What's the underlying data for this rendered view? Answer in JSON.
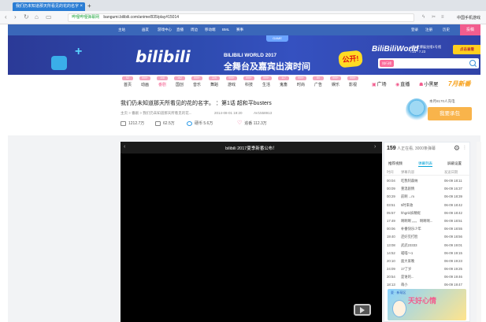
{
  "browser": {
    "tab_title": "我们仍未知道那天所看见的花的名字",
    "tab_close": "×",
    "new_tab": "+",
    "nav_icons": [
      "‹",
      "›",
      "↻",
      "⌂",
      "▭"
    ],
    "site_label": "哔哩哔哩弹幕网",
    "url": "bangumi.bilibili.com/anime/835/play#15014",
    "ext_label": "中国手机游戏"
  },
  "site_nav": {
    "items": [
      "主站",
      "画友",
      "游戏中心",
      "直播",
      "周边",
      "移动端",
      "BML",
      "赛事"
    ],
    "right_items": [
      "登录",
      "注册",
      "历史",
      "历史"
    ],
    "upload": "投稿"
  },
  "banner": {
    "logo": "bilibili",
    "game": "GAME",
    "world": "BILIBILI WORLD 2017",
    "slogan": "全舞台及嘉宾出演时间",
    "badge": "公开!",
    "bw": "BiliBiliWorld",
    "venue_line1": "上海世博展览馆1号馆",
    "venue_line2": "7.21 - 7.23",
    "ticket": "点击查看",
    "search_tag": "排行榜"
  },
  "categories": [
    {
      "badge": "52",
      "label": "首页"
    },
    {
      "badge": "999+",
      "label": "动画"
    },
    {
      "badge": "108",
      "label": "番剧"
    },
    {
      "badge": "162",
      "label": "国创"
    },
    {
      "badge": "999+",
      "label": "音乐"
    },
    {
      "badge": "225",
      "label": "舞蹈"
    },
    {
      "badge": "999+",
      "label": "游戏"
    },
    {
      "badge": "999+",
      "label": "科技"
    },
    {
      "badge": "999+",
      "label": "生活"
    },
    {
      "badge": "117",
      "label": "鬼畜"
    },
    {
      "badge": "999+",
      "label": "时尚"
    },
    {
      "badge": "80",
      "label": "广告"
    },
    {
      "badge": "999+",
      "label": "娱乐"
    },
    {
      "badge": "999+",
      "label": "影视"
    }
  ],
  "category_specials": {
    "guangchang": "广场",
    "zhibo": "直播",
    "xiaoheiwu": "小黑屋",
    "july": "7月新番"
  },
  "video": {
    "title": "我们仍未知道那天所看见的花的名字。 ：第1话 超和平busters",
    "breadcrumb": "主页 > 番剧 > 我们仍未知道那天所看见的花...",
    "pubdate": "2014-08-01 19:20",
    "avid": "AV1558913",
    "plays": "1212.7万",
    "danmaku_count": "62.5万",
    "coins": "硬币 5.6万",
    "favorites": "追番 112.3万"
  },
  "charge": {
    "label": "本月8170人充电",
    "button": "我要承包"
  },
  "player": {
    "title": "bilibili 2017夏季新番公布！",
    "prev": "‹",
    "next": "›"
  },
  "danmaku": {
    "count": "159",
    "count_suffix": "人正在看, 3000条弹幕",
    "gear": "⚙",
    "more": "⋮",
    "tabs": [
      "推荐视频",
      "弹幕列表",
      "屏蔽设置"
    ],
    "columns": [
      "时间",
      "弹幕内容",
      "发送日期"
    ],
    "rows": [
      {
        "t": "00:04",
        "c": "吃我阿森纳",
        "d": "06-09 18:11"
      },
      {
        "t": "00:09",
        "c": "重温剧情",
        "d": "06-09 16:37"
      },
      {
        "t": "00:29",
        "c": "前啊 ...m",
        "d": "06-09 18:39"
      },
      {
        "t": "03:51",
        "c": "5时来收",
        "d": "06-09 18:42"
      },
      {
        "t": "05:57",
        "c": "hhgnb妖精妮",
        "d": "06-09 18:42"
      },
      {
        "t": "17:49",
        "c": "啊啊啊 。。。 啊啊啊...",
        "d": "06-09 18:51"
      },
      {
        "t": "00:06",
        "c": "补番快乐少年",
        "d": "06-09 18:55"
      },
      {
        "t": "19:40",
        "c": "还好见打脸",
        "d": "06-09 18:56"
      },
      {
        "t": "13:08",
        "c": "武武23333",
        "d": "06-09 19:01"
      },
      {
        "t": "14:52",
        "c": "喵喵～1",
        "d": "06-09 19:15"
      },
      {
        "t": "20:10",
        "c": "面大家晚",
        "d": "06-09 19:23"
      },
      {
        "t": "24:09",
        "c": "17了岁",
        "d": "06-09 19:25"
      },
      {
        "t": "20:54",
        "c": "是谁的...",
        "d": "06-09 19:46"
      },
      {
        "t": "18:13",
        "c": "萌小",
        "d": "06-09 19:47"
      },
      {
        "t": "15:00",
        "c": "我以乐...",
        "d": "06-09 19:51"
      }
    ],
    "ad_sub": "夏 · 新萌区",
    "ad_text": "天好心情"
  }
}
